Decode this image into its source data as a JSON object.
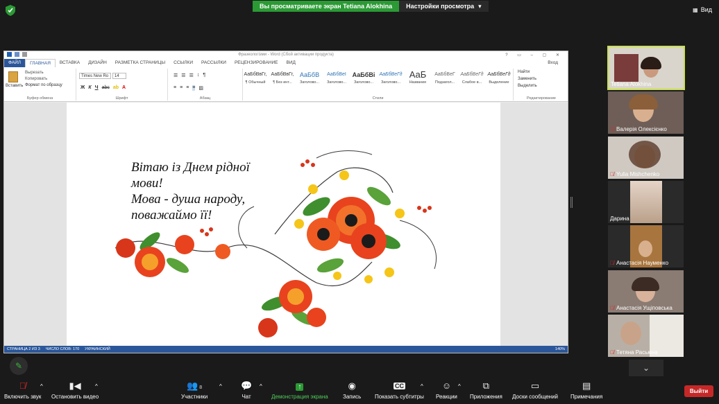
{
  "top_bar": {
    "share_status": "Вы просматриваете экран Tetiana Alokhina",
    "view_settings": "Настройки просмотра",
    "view_button": "Вид"
  },
  "word": {
    "window_title": "Фразеологізми - Word (Сбой активации продукта)",
    "tabs": [
      "ФАЙЛ",
      "ГЛАВНАЯ",
      "ВСТАВКА",
      "ДИЗАЙН",
      "РАЗМЕТКА СТРАНИЦЫ",
      "ССЫЛКИ",
      "РАССЫЛКИ",
      "РЕЦЕНЗИРОВАНИЕ",
      "ВИД"
    ],
    "account_label": "Вход",
    "clipboard": {
      "paste": "Вставить",
      "cut": "Вырезать",
      "copy": "Копировать",
      "format_painter": "Формат по образцу",
      "group": "Буфер обмена"
    },
    "font": {
      "name": "Times New Ro",
      "size": "14",
      "group": "Шрифт"
    },
    "paragraph_group": "Абзац",
    "styles": [
      {
        "sample": "АаБбВвГг,",
        "name": "¶ Обычный"
      },
      {
        "sample": "АаБбВвГг,",
        "name": "¶ Без инт..."
      },
      {
        "sample": "АаБбВ",
        "name": "Заголово..."
      },
      {
        "sample": "АаБбВеІ",
        "name": "Заголово..."
      },
      {
        "sample": "АаБбВі",
        "name": "Заголово..."
      },
      {
        "sample": "АаБбВеГд",
        "name": "Заголово..."
      },
      {
        "sample": "АаБ",
        "name": "Название"
      },
      {
        "sample": "АаБбВеГ",
        "name": "Подзагол..."
      },
      {
        "sample": "АаБбВеГд",
        "name": "Слабое в..."
      },
      {
        "sample": "АаБбВеГд",
        "name": "Выделение"
      }
    ],
    "styles_group": "Стили",
    "editing": {
      "find": "Найти",
      "replace": "Заменить",
      "select": "Выделить",
      "group": "Редактирование"
    },
    "document": {
      "greeting_lines": [
        "Вітаю із Днем рідної",
        "мови!",
        "Мова - душа народу,",
        "поважаймо її!"
      ]
    },
    "status": {
      "page": "СТРАНИЦА 2 ИЗ 3",
      "words": "ЧИСЛО СЛОВ: 170",
      "language": "УКРАИНСКИЙ",
      "zoom": "140%"
    }
  },
  "participants": [
    {
      "name": "Tetiana Alokhina",
      "muted": false,
      "active": true
    },
    {
      "name": "Валерія Олексієнко",
      "muted": true,
      "active": false
    },
    {
      "name": "Yulia Mishchenko",
      "muted": true,
      "active": false
    },
    {
      "name": "Дарина",
      "muted": false,
      "active": false
    },
    {
      "name": "Анастасія Науменко",
      "muted": true,
      "active": false
    },
    {
      "name": "Анастасія Ущіповська",
      "muted": true,
      "active": false
    },
    {
      "name": "Тетяна Раськіна",
      "muted": true,
      "active": false
    }
  ],
  "toolbar": {
    "unmute": "Включить звук",
    "stop_video": "Остановить видео",
    "participants": "Участники",
    "participants_count": "8",
    "chat": "Чат",
    "share_screen": "Демонстрация экрана",
    "record": "Запись",
    "subtitles": "Показать субтитры",
    "reactions": "Реакции",
    "apps": "Приложения",
    "whiteboards": "Доски сообщений",
    "notes": "Примечания",
    "leave": "Выйти"
  },
  "colors": {
    "zoom_green": "#2b9a35",
    "word_blue": "#2b579a",
    "leave_red": "#c62828",
    "active_speaker": "#c8e14b"
  }
}
